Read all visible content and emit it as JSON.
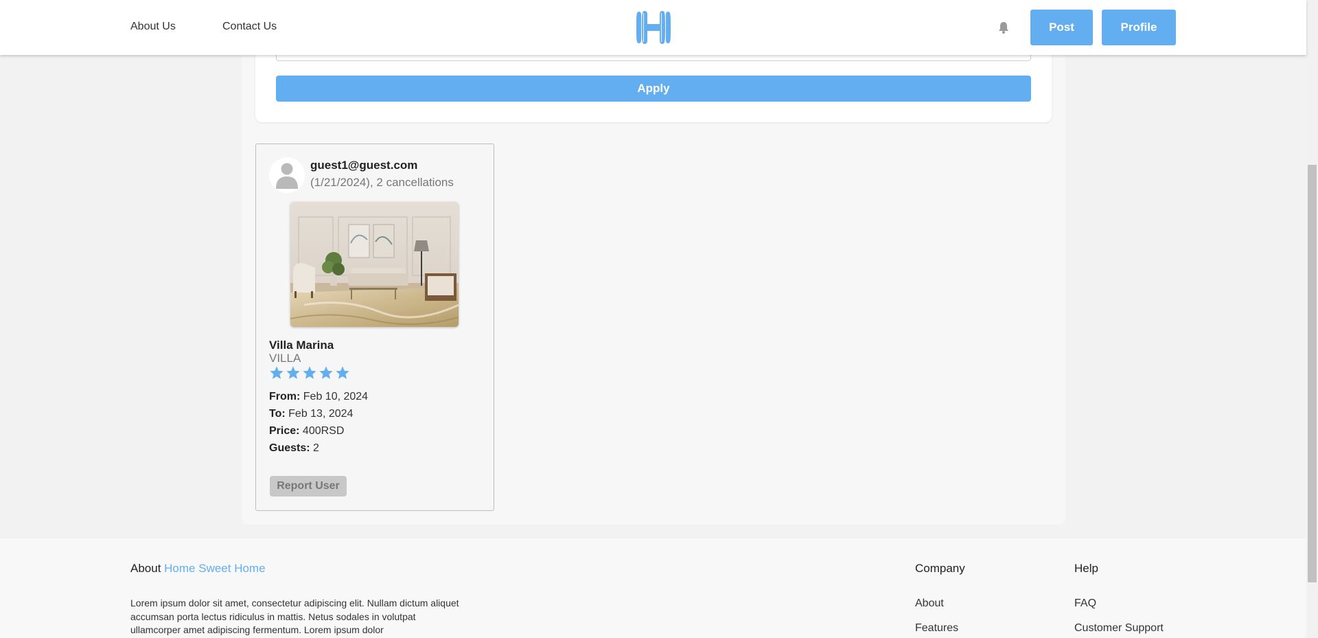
{
  "header": {
    "nav": [
      {
        "label": "About Us"
      },
      {
        "label": "Contact Us"
      }
    ],
    "logo_icon": "house-h-logo",
    "bell_icon": "bell-icon",
    "post_label": "Post",
    "profile_label": "Profile",
    "accent_color": "#63aef0"
  },
  "filters": {
    "apply_label": "Apply"
  },
  "reservation": {
    "guest_email": "guest1@guest.com",
    "guest_meta": "(1/21/2024), 2 cancellations",
    "property_name": "Villa Marina",
    "property_type": "VILLA",
    "rating": 5,
    "rating_max": 5,
    "from_label": "From:",
    "from_value": "Feb 10, 2024",
    "to_label": "To:",
    "to_value": "Feb 13, 2024",
    "price_label": "Price:",
    "price_value": "400RSD",
    "guests_label": "Guests:",
    "guests_value": "2",
    "report_label": "Report User"
  },
  "footer": {
    "about_prefix": "About ",
    "about_brand": "Home Sweet Home",
    "about_text": "Lorem ipsum dolor sit amet, consectetur adipiscing elit. Nullam dictum aliquet accumsan porta lectus ridiculus in mattis. Netus sodales in volutpat ullamcorper amet adipiscing fermentum. Lorem ipsum dolor",
    "company_title": "Company",
    "company_links": [
      {
        "label": "About"
      },
      {
        "label": "Features"
      }
    ],
    "help_title": "Help",
    "help_links": [
      {
        "label": "FAQ"
      },
      {
        "label": "Customer Support"
      }
    ]
  }
}
